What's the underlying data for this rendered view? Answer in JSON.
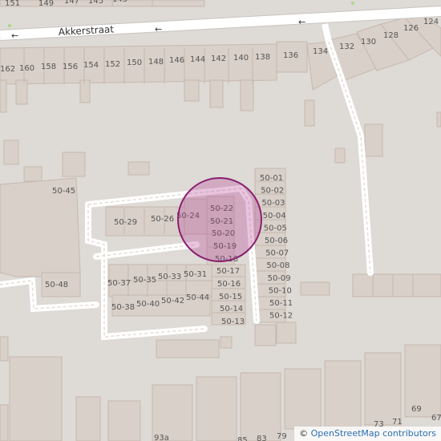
{
  "map": {
    "street_name": "Akkerstraat",
    "attribution_symbol": "©",
    "attribution_link": "OpenStreetMap contributors",
    "colors": {
      "background": "#dedad6",
      "building": "#d9d0c9",
      "building_outline": "#c5b9ae",
      "road": "#ffffff",
      "footway": "#fbfbfb",
      "marker_fill": "#b43c96",
      "marker_stroke": "#8a2070"
    },
    "house_numbers": {
      "top_row": [
        "151",
        "149",
        "147",
        "145",
        "143"
      ],
      "north_row": [
        "162",
        "160",
        "158",
        "156",
        "154",
        "152",
        "150",
        "148",
        "146",
        "144",
        "142",
        "140",
        "138",
        "136",
        "134",
        "132",
        "130",
        "128",
        "126",
        "124"
      ],
      "block_labels": [
        "50-45",
        "50-48",
        "50-29",
        "50-26",
        "50-24",
        "50-22",
        "50-21",
        "50-20",
        "50-19",
        "50-18",
        "50-17",
        "50-16",
        "50-15",
        "50-14",
        "50-13",
        "50-37",
        "50-35",
        "50-33",
        "50-31",
        "50-38",
        "50-40",
        "50-42",
        "50-44"
      ],
      "right_column": [
        "50-01",
        "50-02",
        "50-03",
        "50-04",
        "50-05",
        "50-06",
        "50-07",
        "50-08",
        "50-09",
        "50-10",
        "50-11",
        "50-12"
      ],
      "bottom": [
        "93a",
        "85",
        "83",
        "79",
        "73",
        "71",
        "69",
        "67"
      ]
    }
  }
}
